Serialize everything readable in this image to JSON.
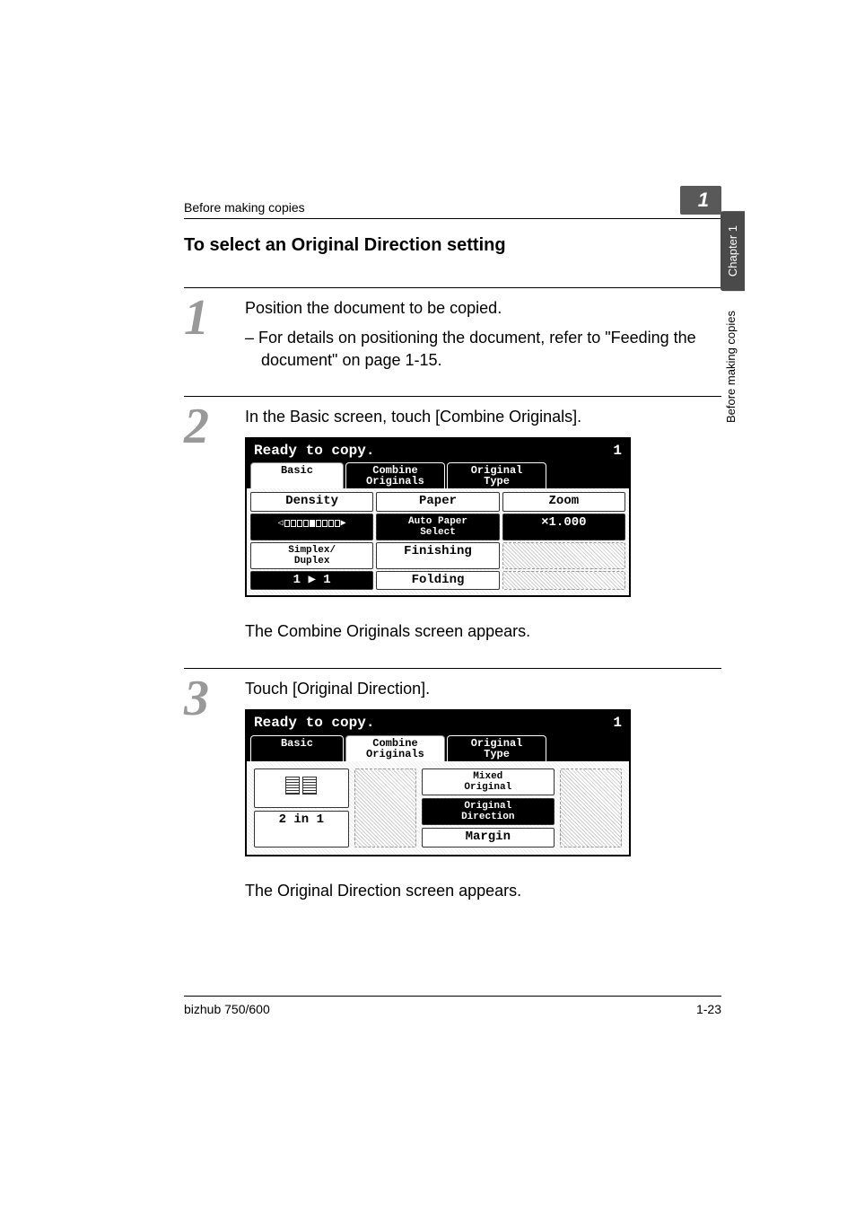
{
  "header": {
    "running_text": "Before making copies",
    "chapter_flag": "1"
  },
  "side_tabs": {
    "dark": "Chapter 1",
    "light": "Before making copies"
  },
  "section_heading": "To select an Original Direction setting",
  "steps": [
    {
      "num": "1",
      "text": "Position the document to be copied.",
      "subitems": [
        "– For details on positioning the document, refer to \"Feeding the document\" on page 1-15."
      ]
    },
    {
      "num": "2",
      "text": "In the Basic screen, touch [Combine Originals].",
      "followup": "The Combine Originals screen appears."
    },
    {
      "num": "3",
      "text": "Touch [Original Direction].",
      "followup": "The Original Direction screen appears."
    }
  ],
  "lcd1": {
    "status": "Ready to copy.",
    "count": "1",
    "tabs": [
      "Basic",
      "Combine\nOriginals",
      "Original\nType"
    ],
    "row1": {
      "density_label": "Density",
      "paper_label": "Paper",
      "zoom_label": "Zoom"
    },
    "row2": {
      "paper_mode": "Auto Paper\nSelect",
      "zoom_value": "×1.000"
    },
    "row3": {
      "simplex_label": "Simplex/\nDuplex",
      "finishing_label": "Finishing"
    },
    "row4": {
      "simplex_value_left": "1",
      "simplex_value_right": "1",
      "folding_label": "Folding"
    }
  },
  "lcd2": {
    "status": "Ready to copy.",
    "count": "1",
    "tabs": [
      "Basic",
      "Combine\nOriginals",
      "Original\nType"
    ],
    "left_label": "2 in 1",
    "btn_mixed": "Mixed\nOriginal",
    "btn_direction": "Original\nDirection",
    "btn_margin": "Margin"
  },
  "footer": {
    "model": "bizhub 750/600",
    "page": "1-23"
  }
}
